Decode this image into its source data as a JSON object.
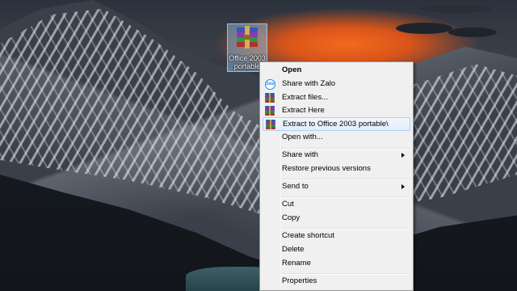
{
  "desktop": {
    "icon": {
      "label_line1": "Office 2003",
      "label_line2": "portable",
      "icon_name": "winrar-archive-icon"
    }
  },
  "context_menu": {
    "items": [
      {
        "label": "Open",
        "bold": true
      },
      {
        "label": "Share with Zalo",
        "icon": "zalo-icon"
      },
      {
        "label": "Extract files...",
        "icon": "winrar-icon"
      },
      {
        "label": "Extract Here",
        "icon": "winrar-icon"
      },
      {
        "label": "Extract to Office 2003 portable\\",
        "icon": "winrar-icon",
        "highlighted": true
      },
      {
        "label": "Open with..."
      },
      {
        "label": "Share with",
        "submenu": true
      },
      {
        "label": "Restore previous versions"
      },
      {
        "label": "Send to",
        "submenu": true
      },
      {
        "label": "Cut"
      },
      {
        "label": "Copy"
      },
      {
        "label": "Create shortcut"
      },
      {
        "label": "Delete"
      },
      {
        "label": "Rename"
      },
      {
        "label": "Properties"
      }
    ]
  },
  "colors": {
    "menu_bg": "#f0f0f0",
    "highlight_border": "#aecff7",
    "sunset": "#f26a1e"
  }
}
